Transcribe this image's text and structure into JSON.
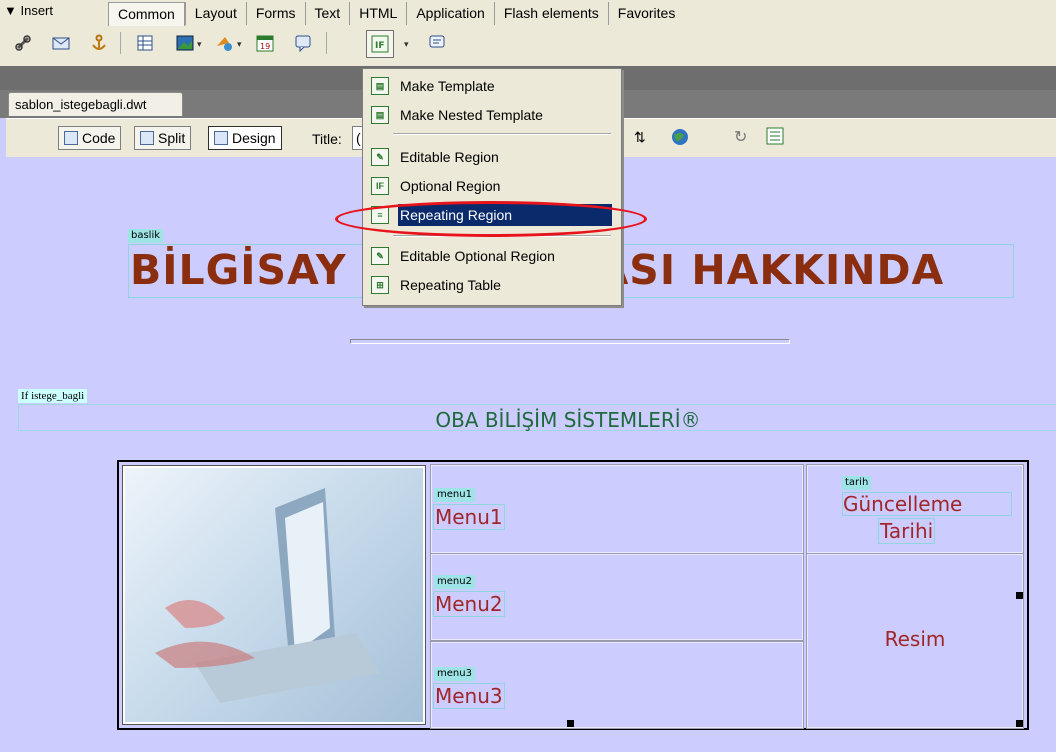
{
  "insert_bar": {
    "label": "▼ Insert",
    "tabs": [
      "Common",
      "Layout",
      "Forms",
      "Text",
      "HTML",
      "Application",
      "Flash elements",
      "Favorites"
    ],
    "active_tab": "Common"
  },
  "document": {
    "tab_name": "sablon_istegebagli.dwt",
    "view_buttons": {
      "code": "Code",
      "split": "Split",
      "design": "Design"
    },
    "title_label": "Title:",
    "title_value": "("
  },
  "template_menu": {
    "items": [
      {
        "label": "Make Template",
        "icon": "make-template-icon"
      },
      {
        "label": "Make Nested Template",
        "icon": "make-nested-template-icon"
      },
      {
        "label": "Editable Region",
        "icon": "editable-region-icon"
      },
      {
        "label": "Optional Region",
        "icon": "optional-region-icon"
      },
      {
        "label": "Repeating Region",
        "icon": "repeating-region-icon",
        "highlighted": true
      },
      {
        "label": "Editable Optional Region",
        "icon": "editable-optional-region-icon"
      },
      {
        "label": "Repeating Table",
        "icon": "repeating-table-icon"
      }
    ]
  },
  "design_view": {
    "title_region_tag": "baslik",
    "page_title_visible_left": "BİLGİSAY",
    "page_title_visible_right": "ASI HAKKINDA",
    "if_region_tag": "If istege_bagli",
    "company_text": "OBA BİLİŞİM SİSTEMLERİ®",
    "menus": [
      {
        "tag": "menu1",
        "label": "Menu1"
      },
      {
        "tag": "menu2",
        "label": "Menu2"
      },
      {
        "tag": "menu3",
        "label": "Menu3"
      }
    ],
    "date_tag": "tarih",
    "date_label_line1": "Güncelleme",
    "date_label_line2": "Tarihi",
    "image_label": "Resim"
  },
  "colors": {
    "page_background": "#ccccff",
    "title_color": "#8b2e10",
    "company_color": "#1f6a3c",
    "menu_color": "#a0262a",
    "highlight": "#0a2a6b",
    "annotation": "#e8141c"
  }
}
